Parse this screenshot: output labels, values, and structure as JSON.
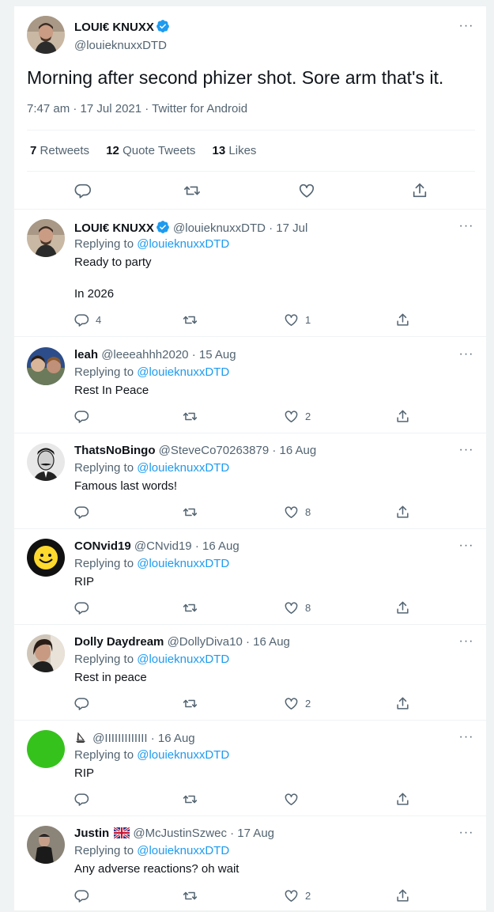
{
  "main": {
    "display_name": "LOUI€ KNUXX",
    "handle": "@louieknuxxDTD",
    "text": "Morning after second phizer shot. Sore arm that's it.",
    "meta": "7:47 am · 17 Jul 2021 · Twitter for Android",
    "stats": {
      "retweets_num": "7",
      "retweets_label": "Retweets",
      "quotes_num": "12",
      "quotes_label": "Quote Tweets",
      "likes_num": "13",
      "likes_label": "Likes"
    }
  },
  "replying_label": "Replying to",
  "replying_handle": "@louieknuxxDTD",
  "more_glyph": "···",
  "replies": [
    {
      "name": "LOUI€ KNUXX",
      "handle": "@louieknuxxDTD",
      "date": "· 17 Jul",
      "text": "Ready to party\n\nIn 2026",
      "replies": "4",
      "likes": "1"
    },
    {
      "name": "leah",
      "handle": "@leeeahhh2020",
      "date": "· 15 Aug",
      "text": "Rest In Peace",
      "replies": "",
      "likes": "2"
    },
    {
      "name": "ThatsNoBingo",
      "handle": "@SteveCo70263879",
      "date": "· 16 Aug",
      "text": "Famous last words!",
      "replies": "",
      "likes": "8"
    },
    {
      "name": "CONvid19",
      "handle": "@CNvid19",
      "date": "· 16 Aug",
      "text": "RIP",
      "replies": "",
      "likes": "8"
    },
    {
      "name": "Dolly Daydream",
      "handle": "@DollyDiva10",
      "date": "· 16 Aug",
      "text": "Rest in peace",
      "replies": "",
      "likes": "2"
    },
    {
      "name": "",
      "handle": "@IIIIIIIIIIIII",
      "date": "· 16 Aug",
      "text": "RIP",
      "replies": "",
      "likes": ""
    },
    {
      "name": "Justin",
      "handle": "@McJustinSzwec",
      "date": "· 17 Aug",
      "text": "Any adverse reactions? oh wait",
      "replies": "",
      "likes": "2"
    }
  ],
  "colors": {
    "verified": "#1d9bf0",
    "link": "#1d9bf0",
    "muted": "#536471",
    "text": "#0f1419"
  },
  "icons": [
    "verified-badge-icon",
    "reply-icon",
    "retweet-icon",
    "like-icon",
    "share-icon",
    "more-icon",
    "ship-icon",
    "uk-flag-icon"
  ]
}
